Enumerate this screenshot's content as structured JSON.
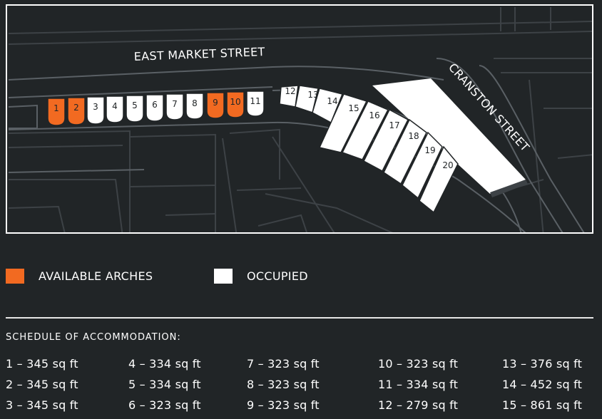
{
  "map": {
    "streets": {
      "east_market": "EAST MARKET STREET",
      "cranston": "CRANSTON STREET"
    },
    "colors": {
      "background": "#212527",
      "available": "#f26a21",
      "occupied": "#ffffff",
      "building_outline": "#3d4246",
      "road_line": "#5a6065"
    },
    "arches": [
      {
        "num": "1",
        "status": "available"
      },
      {
        "num": "2",
        "status": "available"
      },
      {
        "num": "3",
        "status": "occupied"
      },
      {
        "num": "4",
        "status": "occupied"
      },
      {
        "num": "5",
        "status": "occupied"
      },
      {
        "num": "6",
        "status": "occupied"
      },
      {
        "num": "7",
        "status": "occupied"
      },
      {
        "num": "8",
        "status": "occupied"
      },
      {
        "num": "9",
        "status": "available"
      },
      {
        "num": "10",
        "status": "available"
      },
      {
        "num": "11",
        "status": "occupied"
      },
      {
        "num": "12",
        "status": "occupied"
      },
      {
        "num": "13",
        "status": "occupied"
      },
      {
        "num": "14",
        "status": "occupied"
      },
      {
        "num": "15",
        "status": "occupied"
      },
      {
        "num": "16",
        "status": "occupied"
      },
      {
        "num": "17",
        "status": "occupied"
      },
      {
        "num": "18",
        "status": "occupied"
      },
      {
        "num": "19",
        "status": "occupied"
      },
      {
        "num": "20",
        "status": "occupied"
      }
    ]
  },
  "legend": {
    "available_label": "AVAILABLE ARCHES",
    "occupied_label": "OCCUPIED"
  },
  "schedule": {
    "title": "SCHEDULE OF ACCOMMODATION:",
    "columns": [
      [
        "1 – 345 sq ft",
        "2 – 345 sq ft",
        "3 – 345 sq ft"
      ],
      [
        "4 – 334 sq ft",
        "5 – 334 sq ft",
        "6 – 323 sq ft"
      ],
      [
        "7 – 323 sq ft",
        "8 – 323 sq ft",
        "9 – 323 sq ft"
      ],
      [
        "10 – 323 sq ft",
        "11 – 334 sq ft",
        "12 – 279 sq ft"
      ],
      [
        "13 – 376 sq ft",
        "14 – 452 sq ft",
        "15 – 861 sq ft"
      ]
    ]
  }
}
